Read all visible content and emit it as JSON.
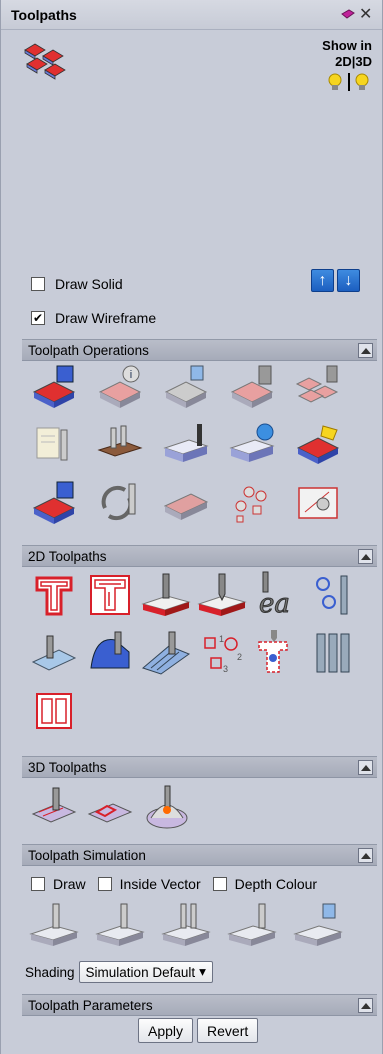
{
  "panel": {
    "title": "Toolpaths",
    "show_in_label": "Show in",
    "view_toggle": "2D|3D",
    "draw_solid": {
      "label": "Draw Solid",
      "checked": false
    },
    "draw_wireframe": {
      "label": "Draw Wireframe",
      "checked": true
    }
  },
  "sections": {
    "operations": "Toolpath Operations",
    "toolpaths_2d": "2D Toolpaths",
    "toolpaths_3d": "3D Toolpaths",
    "simulation": "Toolpath Simulation",
    "parameters": "Toolpath Parameters"
  },
  "simulation": {
    "draw_label": "Draw",
    "inside_vector_label": "Inside Vector",
    "depth_colour_label": "Depth Colour",
    "shading_label": "Shading",
    "shading_value": "Simulation Default"
  },
  "buttons": {
    "apply": "Apply",
    "revert": "Revert"
  },
  "colors": {
    "accent": "#1c5fc0",
    "header": "#a6abb9",
    "background": "#c8ccd8",
    "toolpath_red": "#d8202a"
  },
  "icons": {
    "operations": [
      "save-toolpath-icon",
      "toolpath-info-icon",
      "delete-toolpath-icon",
      "toolpath-summary-icon",
      "merge-toolpaths-icon",
      "tool-database-icon",
      "toolpath-templates-icon",
      "material-setup-icon",
      "reset-preview-icon",
      "save-template-icon",
      "save-all-icon",
      "recalculate-icon",
      "visible-toolpaths-icon",
      "batch-visibility-icon",
      "move-toolpath-icon"
    ],
    "toolpaths_2d": [
      "profile-toolpath-icon",
      "pocket-toolpath-icon",
      "drilling-toolpath-icon",
      "vcarve-toolpath-icon",
      "quick-engrave-icon",
      "texture-toolpath-icon",
      "fluting-toolpath-icon",
      "prism-carve-icon",
      "moulding-toolpath-icon",
      "drill-order-icon",
      "inlay-toolpath-icon",
      "multi-tool-icon",
      "chamfer-toolpath-icon"
    ],
    "toolpaths_3d": [
      "roughing-toolpath-icon",
      "finishing-toolpath-icon",
      "profile-3d-icon"
    ],
    "simulation": [
      "simulate-all-icon",
      "simulate-toolpath-icon",
      "simulate-selected-icon",
      "reset-simulation-icon",
      "simulation-settings-icon"
    ]
  }
}
